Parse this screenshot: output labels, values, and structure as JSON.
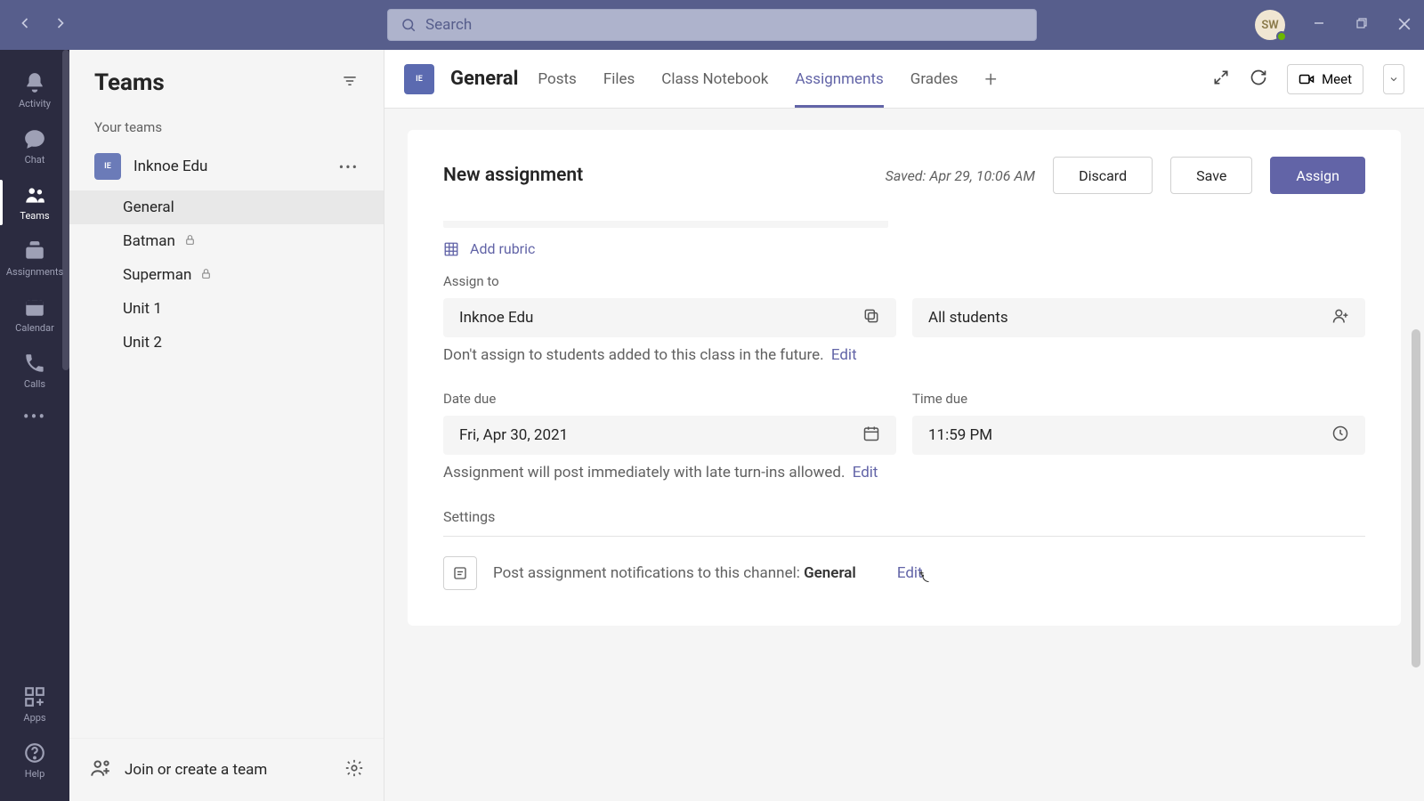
{
  "titlebar": {
    "search_placeholder": "Search",
    "user_initials": "SW"
  },
  "rail": {
    "items": [
      {
        "label": "Activity"
      },
      {
        "label": "Chat"
      },
      {
        "label": "Teams"
      },
      {
        "label": "Assignments"
      },
      {
        "label": "Calendar"
      },
      {
        "label": "Calls"
      }
    ],
    "apps_label": "Apps",
    "help_label": "Help"
  },
  "sidebar": {
    "title": "Teams",
    "section_label": "Your teams",
    "team": {
      "name": "Inknoe Edu"
    },
    "channels": [
      {
        "label": "General",
        "locked": false,
        "active": true
      },
      {
        "label": "Batman",
        "locked": true,
        "active": false
      },
      {
        "label": "Superman",
        "locked": true,
        "active": false
      },
      {
        "label": "Unit 1",
        "locked": false,
        "active": false
      },
      {
        "label": "Unit 2",
        "locked": false,
        "active": false
      }
    ],
    "join_label": "Join or create a team"
  },
  "header": {
    "channel_name": "General",
    "tabs": [
      {
        "label": "Posts"
      },
      {
        "label": "Files"
      },
      {
        "label": "Class Notebook"
      },
      {
        "label": "Assignments"
      },
      {
        "label": "Grades"
      }
    ],
    "meet_label": "Meet"
  },
  "assignment": {
    "title": "New assignment",
    "saved_text": "Saved: Apr 29, 10:06 AM",
    "discard_label": "Discard",
    "save_label": "Save",
    "assign_label": "Assign",
    "add_rubric_label": "Add rubric",
    "assign_to_label": "Assign to",
    "class_value": "Inknoe Edu",
    "students_value": "All students",
    "assign_helper": "Don't assign to students added to this class in the future.",
    "edit_label": "Edit",
    "date_due_label": "Date due",
    "date_due_value": "Fri, Apr 30, 2021",
    "time_due_label": "Time due",
    "time_due_value": "11:59 PM",
    "date_helper": "Assignment will post immediately with late turn-ins allowed.",
    "settings_label": "Settings",
    "notification_prefix": "Post assignment notifications to this channel: ",
    "notification_channel": "General"
  }
}
